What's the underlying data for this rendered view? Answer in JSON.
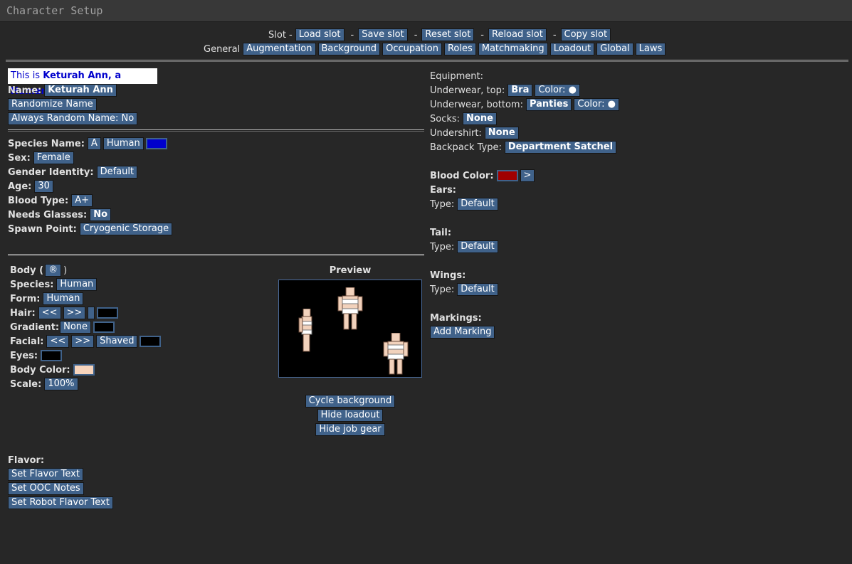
{
  "window": {
    "title": "Character Setup"
  },
  "slot_bar": {
    "label": "Slot -",
    "buttons": [
      "Load slot",
      "Save slot",
      "Reset slot",
      "Reload slot",
      "Copy slot"
    ],
    "dash": "-"
  },
  "tabs": {
    "current": "General",
    "items": [
      "Augmentation",
      "Background",
      "Occupation",
      "Roles",
      "Matchmaking",
      "Loadout",
      "Global",
      "Laws"
    ]
  },
  "identity": {
    "intro_prefix": "This is ",
    "intro_name": "Keturah Ann, a Human",
    "intro_suffix": "!",
    "name_label": "Name:",
    "name_value": "Keturah Ann",
    "randomize_label": "Randomize Name",
    "always_random_label": "Always Random Name: No"
  },
  "species": {
    "species_name_label": "Species Name:",
    "species_name_a": "A",
    "species_name_value": "Human",
    "species_color": "#0000cc",
    "sex_label": "Sex:",
    "sex_value": "Female",
    "gender_label": "Gender Identity:",
    "gender_value": "Default",
    "age_label": "Age:",
    "age_value": "30",
    "blood_type_label": "Blood Type:",
    "blood_type_value": "A+",
    "glasses_label": "Needs Glasses:",
    "glasses_value": "No",
    "spawn_label": "Spawn Point:",
    "spawn_value": "Cryogenic Storage"
  },
  "body": {
    "body_label": "Body (",
    "body_icon": "®",
    "body_close": ")",
    "species_label": "Species:",
    "species_value": "Human",
    "form_label": "Form:",
    "form_value": "Human",
    "hair_label": "Hair:",
    "prev": "<<",
    "next": ">>",
    "hair_color": "#000000",
    "gradient_label": "Gradient:",
    "gradient_value": "None",
    "gradient_color": "#000000",
    "facial_label": "Facial:",
    "facial_value": "Shaved",
    "facial_color": "#000000",
    "eyes_label": "Eyes:",
    "eyes_color": "#000000",
    "body_color_label": "Body Color:",
    "body_color": "#f7d4bc",
    "scale_label": "Scale:",
    "scale_value": "100%"
  },
  "preview": {
    "title": "Preview",
    "cycle": "Cycle background",
    "hide_loadout": "Hide loadout",
    "hide_job_gear": "Hide job gear"
  },
  "flavor": {
    "label": "Flavor:",
    "set_flavor": "Set Flavor Text",
    "set_ooc": "Set OOC Notes",
    "set_robot": "Set Robot Flavor Text"
  },
  "equipment": {
    "label": "Equipment:",
    "uw_top_label": "Underwear, top:",
    "uw_top_value": "Bra",
    "color_label": "Color: ●",
    "uw_bottom_label": "Underwear, bottom:",
    "uw_bottom_value": "Panties",
    "socks_label": "Socks:",
    "socks_value": "None",
    "undershirt_label": "Undershirt:",
    "undershirt_value": "None",
    "backpack_label": "Backpack Type:",
    "backpack_value": "Department Satchel"
  },
  "features": {
    "blood_color_label": "Blood Color:",
    "blood_color": "#a00000",
    "blood_next": ">",
    "ears_label": "Ears:",
    "type_label": "Type:",
    "default_value": "Default",
    "tail_label": "Tail:",
    "wings_label": "Wings:",
    "markings_label": "Markings:",
    "add_marking": "Add Marking"
  }
}
